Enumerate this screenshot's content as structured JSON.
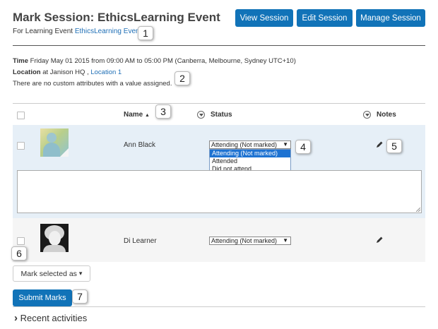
{
  "header": {
    "title": "Mark Session: EthicsLearning Event",
    "subtitle_prefix": "For Learning Event",
    "subtitle_link": "EthicsLearning Event",
    "buttons": {
      "view_session": "View Session",
      "edit_session": "Edit Session",
      "manage_session": "Manage Session"
    }
  },
  "details": {
    "time_label": "Time",
    "time_value": "Friday May 01 2015 from 09:00 AM to 05:00 PM (Canberra, Melbourne, Sydney UTC+10)",
    "location_label": "Location",
    "location_value": "at Janison HQ ,",
    "location_link": "Location 1",
    "custom_attributes": "There are no custom attributes with a value assigned."
  },
  "table": {
    "columns": {
      "name": "Name",
      "sort_indicator": "▲",
      "status": "Status",
      "notes": "Notes"
    },
    "rows": [
      {
        "name": "Ann Black",
        "status": "Attending (Not marked)",
        "avatar": "generic-person-avatar"
      },
      {
        "name": "Di Learner",
        "status": "Attending (Not marked)",
        "avatar": "photo-avatar"
      }
    ],
    "status_options": [
      "Attending (Not marked)",
      "Attended",
      "Did not attend"
    ],
    "select_arrow": "▼"
  },
  "actions": {
    "mark_selected": "Mark selected as",
    "mark_caret": "▾",
    "submit": "Submit Marks"
  },
  "recent": {
    "chevron": "›",
    "label": "Recent activities"
  },
  "callouts": [
    "1",
    "2",
    "3",
    "4",
    "5",
    "6",
    "7"
  ],
  "colors": {
    "primary_button": "#1173b8",
    "link": "#1f6fb6",
    "selected_row": "#e6eff7",
    "dropdown_highlight": "#1e73d2"
  },
  "icons": {
    "filter": "funnel-circle-icon",
    "notes": "pencil-icon",
    "chevron": "chevron-right-icon"
  }
}
